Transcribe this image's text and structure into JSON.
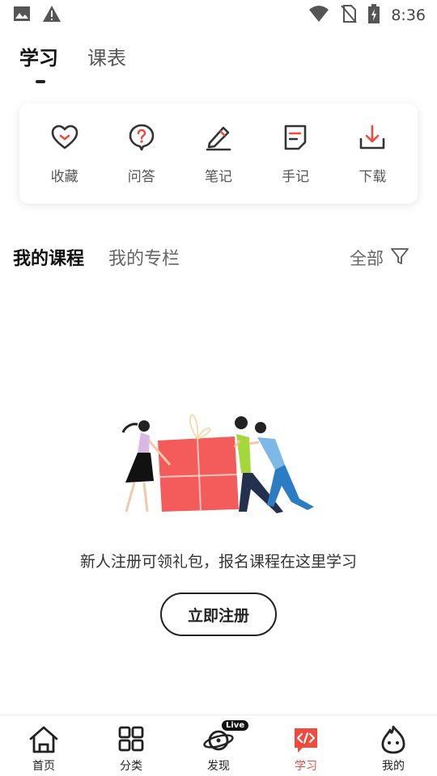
{
  "status_bar": {
    "time": "8:36",
    "icons": [
      "image-icon",
      "warning-icon",
      "wifi-icon",
      "no-sim-icon",
      "battery-charging-icon"
    ]
  },
  "top_tabs": [
    {
      "label": "学习",
      "active": true
    },
    {
      "label": "课表",
      "active": false
    }
  ],
  "tools": [
    {
      "label": "收藏",
      "icon": "heart-icon"
    },
    {
      "label": "问答",
      "icon": "question-bubble-icon"
    },
    {
      "label": "笔记",
      "icon": "pen-icon"
    },
    {
      "label": "手记",
      "icon": "note-icon"
    },
    {
      "label": "下载",
      "icon": "download-icon"
    }
  ],
  "section_tabs": [
    {
      "label": "我的课程",
      "active": true
    },
    {
      "label": "我的专栏",
      "active": false
    }
  ],
  "filter": {
    "label": "全部",
    "icon": "filter-icon"
  },
  "empty_state": {
    "message": "新人注册可领礼包，报名课程在这里学习",
    "button_label": "立即注册"
  },
  "bottom_nav": [
    {
      "label": "首页",
      "icon": "home-icon",
      "active": false
    },
    {
      "label": "分类",
      "icon": "grid-icon",
      "active": false
    },
    {
      "label": "发现",
      "icon": "planet-icon",
      "badge": "Live",
      "active": false
    },
    {
      "label": "学习",
      "icon": "code-icon",
      "active": true
    },
    {
      "label": "我的",
      "icon": "flame-face-icon",
      "active": false
    }
  ],
  "colors": {
    "accent": "#ef4a3c",
    "text": "#222222",
    "muted": "#666666"
  }
}
